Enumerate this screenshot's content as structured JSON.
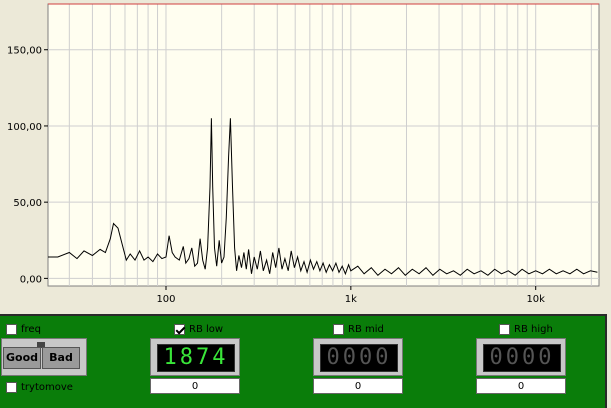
{
  "chart_data": {
    "type": "line",
    "x_scale": "log",
    "xlim": [
      23,
      22000
    ],
    "ylim": [
      -5,
      180
    ],
    "y_ticks": [
      0,
      50,
      100,
      150
    ],
    "y_tick_labels": [
      "0,00",
      "50,00",
      "100,00",
      "150,00"
    ],
    "x_ticks": [
      100,
      1000,
      10000
    ],
    "x_tick_labels": [
      "100",
      "1k",
      "10k"
    ],
    "grid": true,
    "reference_line": 180,
    "series": [
      {
        "values": [
          [
            23,
            14
          ],
          [
            26,
            14
          ],
          [
            30,
            17
          ],
          [
            33,
            13
          ],
          [
            36,
            18
          ],
          [
            40,
            15
          ],
          [
            44,
            19
          ],
          [
            47,
            17
          ],
          [
            50,
            26
          ],
          [
            52,
            36
          ],
          [
            55,
            33
          ],
          [
            58,
            22
          ],
          [
            61,
            12
          ],
          [
            64,
            16
          ],
          [
            68,
            12
          ],
          [
            72,
            18
          ],
          [
            76,
            12
          ],
          [
            80,
            14
          ],
          [
            85,
            11
          ],
          [
            90,
            16
          ],
          [
            95,
            13
          ],
          [
            100,
            14
          ],
          [
            104,
            28
          ],
          [
            108,
            17
          ],
          [
            112,
            14
          ],
          [
            118,
            12
          ],
          [
            124,
            21
          ],
          [
            128,
            10
          ],
          [
            133,
            13
          ],
          [
            138,
            20
          ],
          [
            143,
            8
          ],
          [
            148,
            10
          ],
          [
            153,
            26
          ],
          [
            158,
            12
          ],
          [
            163,
            6
          ],
          [
            168,
            20
          ],
          [
            173,
            60
          ],
          [
            176,
            105
          ],
          [
            179,
            60
          ],
          [
            183,
            20
          ],
          [
            188,
            8
          ],
          [
            194,
            25
          ],
          [
            200,
            10
          ],
          [
            206,
            14
          ],
          [
            212,
            40
          ],
          [
            218,
            80
          ],
          [
            223,
            105
          ],
          [
            229,
            60
          ],
          [
            235,
            20
          ],
          [
            241,
            5
          ],
          [
            248,
            15
          ],
          [
            256,
            7
          ],
          [
            264,
            17
          ],
          [
            272,
            6
          ],
          [
            280,
            19
          ],
          [
            290,
            3
          ],
          [
            300,
            14
          ],
          [
            312,
            6
          ],
          [
            324,
            18
          ],
          [
            336,
            5
          ],
          [
            350,
            12
          ],
          [
            364,
            3
          ],
          [
            378,
            17
          ],
          [
            392,
            7
          ],
          [
            408,
            20
          ],
          [
            424,
            6
          ],
          [
            440,
            13
          ],
          [
            458,
            5
          ],
          [
            476,
            18
          ],
          [
            495,
            7
          ],
          [
            515,
            14
          ],
          [
            536,
            5
          ],
          [
            558,
            11
          ],
          [
            580,
            4
          ],
          [
            604,
            12
          ],
          [
            628,
            6
          ],
          [
            654,
            11
          ],
          [
            680,
            5
          ],
          [
            708,
            10
          ],
          [
            736,
            4
          ],
          [
            766,
            9
          ],
          [
            797,
            5
          ],
          [
            830,
            10
          ],
          [
            863,
            4
          ],
          [
            898,
            8
          ],
          [
            934,
            3
          ],
          [
            972,
            9
          ],
          [
            1000,
            5
          ],
          [
            1090,
            8
          ],
          [
            1180,
            3
          ],
          [
            1290,
            7
          ],
          [
            1400,
            2
          ],
          [
            1530,
            6
          ],
          [
            1660,
            3
          ],
          [
            1810,
            7
          ],
          [
            1970,
            2
          ],
          [
            2150,
            6
          ],
          [
            2340,
            3
          ],
          [
            2550,
            7
          ],
          [
            2780,
            2
          ],
          [
            3030,
            6
          ],
          [
            3300,
            3
          ],
          [
            3590,
            5
          ],
          [
            3910,
            2
          ],
          [
            4260,
            6
          ],
          [
            4640,
            3
          ],
          [
            5060,
            5
          ],
          [
            5510,
            2
          ],
          [
            6000,
            6
          ],
          [
            6530,
            3
          ],
          [
            7110,
            5
          ],
          [
            7750,
            2
          ],
          [
            8440,
            6
          ],
          [
            9190,
            3
          ],
          [
            10000,
            5
          ],
          [
            10890,
            3
          ],
          [
            11860,
            6
          ],
          [
            12920,
            3
          ],
          [
            14070,
            5
          ],
          [
            15320,
            3
          ],
          [
            16690,
            6
          ],
          [
            18170,
            3
          ],
          [
            19790,
            5
          ],
          [
            21560,
            4
          ]
        ]
      }
    ]
  },
  "controls": {
    "freq_label": "freq",
    "freq_checked": false,
    "trytomove_label": "trytomove",
    "trytomove_checked": false,
    "good_label": "Good",
    "bad_label": "Bad",
    "rb_low": {
      "label": "RB low",
      "checked": true,
      "display": "1874",
      "value": "0"
    },
    "rb_mid": {
      "label": "RB mid",
      "checked": false,
      "display": "0000",
      "value": "0"
    },
    "rb_high": {
      "label": "RB high",
      "checked": false,
      "display": "0000",
      "value": "0"
    }
  },
  "colors": {
    "plot_bg": "#fffef0",
    "grid": "#cfcfcf",
    "reference_line": "#d04040",
    "panel": "#0a7d0a",
    "digit_on": "#39e639",
    "digit_off": "#555555"
  }
}
